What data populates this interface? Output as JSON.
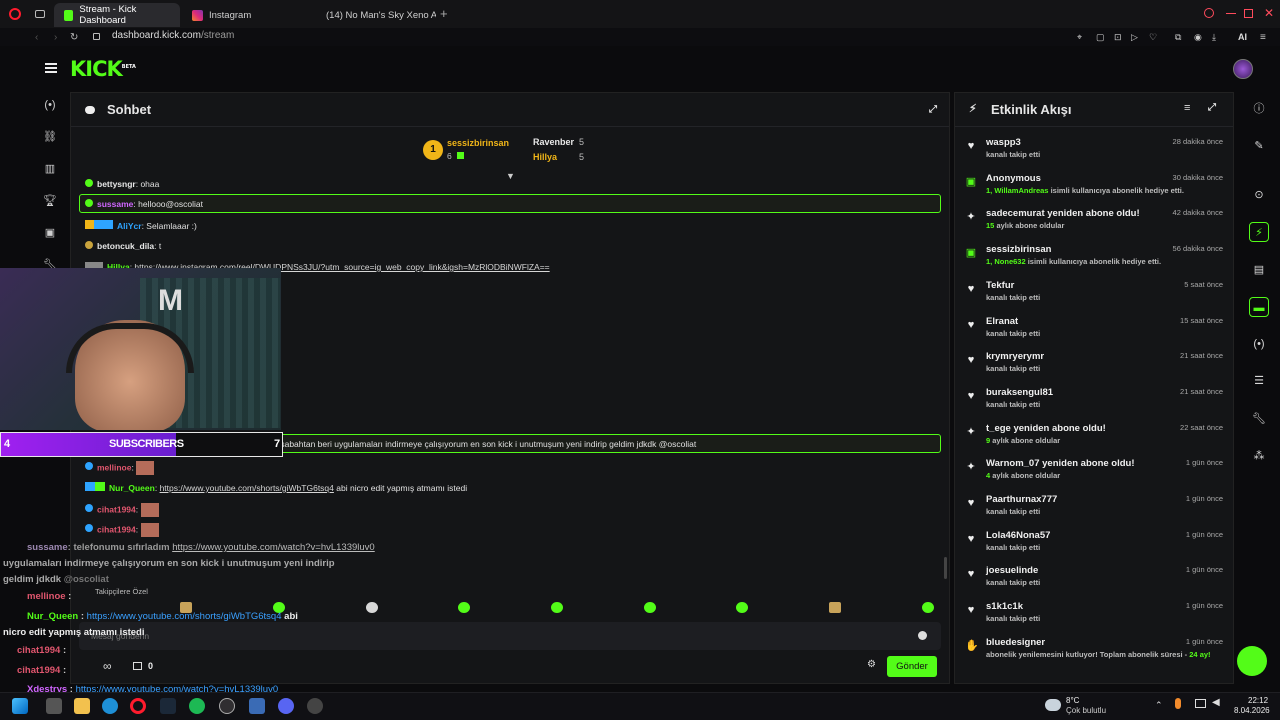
{
  "browser": {
    "tabs": [
      {
        "label": "Stream - Kick Dashboard",
        "color": "#53fc18"
      },
      {
        "label": "Instagram",
        "color": "#e1306c"
      },
      {
        "label": "(14) No Man's Sky Xeno A",
        "color": "#ff0000"
      }
    ],
    "url_host": "dashboard.kick.com",
    "url_path": "/stream",
    "ai_label": "AI"
  },
  "kick": {
    "logo": "KICK",
    "beta": "BETA"
  },
  "chat": {
    "title": "Sohbet",
    "top_supporters": [
      {
        "rank": "1",
        "name": "sessizbirinsan",
        "count": "6"
      },
      {
        "name": "Ravenber",
        "count": "5"
      },
      {
        "name": "Hillya",
        "count": "5"
      }
    ],
    "messages": [
      {
        "user": "bettysngr",
        "text": ": ohaa",
        "color": "#e8e8e8"
      },
      {
        "user": "sussame",
        "text": ": hellooo@oscoliat",
        "color": "#d066ff"
      },
      {
        "user": "AliYcr",
        "text": ": Selamlaaar :)",
        "color": "#2ea4ff"
      },
      {
        "user": "betoncuk_dila",
        "text": ": t",
        "color": "#e8e8e8"
      },
      {
        "user": "Hillya",
        "link": "https://www.instagram.com/reel/DWUDPNSs3JU/?utm_source=ig_web_copy_link&igsh=MzRlODBiNWFlZA==",
        "color": "#53fc18"
      },
      {
        "text": "onumu sıfırladım yanlışlıkla sabahtan beri uygulamaları indirmeye çalışıyorum en son kick i unutmuşum yeni indirip geldim jdkdk @oscoliat"
      },
      {
        "user": "mellinoe",
        "text": ":",
        "color": "#e0566e"
      },
      {
        "user": "Nur_Queen",
        "link": "https://www.youtube.com/shorts/giWbTG6tsq4",
        "text": "abi nicro edit yapmış atmamı istedi",
        "color": "#53fc18"
      },
      {
        "user": "cihat1994",
        "text": ":",
        "color": "#e0566e"
      },
      {
        "user": "cihat1994",
        "text": ":",
        "color": "#e0566e"
      }
    ],
    "overlay": {
      "l1_user": "sussame",
      "l1_text": ": telefonumu sıfırladım",
      "l1_link": "https://www.youtube.com/watch?v=hvL1339luv0",
      "l2": "uygulamaları indirmeye çalışıyorum en son kick i unutmuşum yeni indirip",
      "l3": "geldim jdkdk",
      "l3_mention": "@oscoliat",
      "l4_user": "mellinoe",
      "l5_user": "Nur_Queen",
      "l5_link": "https://www.youtube.com/shorts/giWbTG6tsq4",
      "l5_text": "abi",
      "l6": "nicro edit yapmış atmamı istedi",
      "l7_user": "cihat1994",
      "l8_user": "cihat1994",
      "l9_user": "Xdestrys",
      "l9_link": "https://www.youtube.com/watch?v=hvL1339luv0"
    },
    "followers_only": "Takipçilere Özel",
    "input_placeholder": "Mesaj gönderin",
    "infinity": "∞",
    "count": "0",
    "send_label": "Gönder",
    "webcam_counter_left": "4",
    "webcam_counter_right": "7",
    "subscribers_label": "SUBSCRIBERS"
  },
  "activity": {
    "title": "Etkinlik Akışı",
    "items": [
      {
        "icon": "heart",
        "name": "waspp3",
        "sub": "kanalı takip etti",
        "time": "28 dakika önce"
      },
      {
        "icon": "gift",
        "name": "Anonymous",
        "sub_count": "1,",
        "sub_user": "WillamAndreas",
        "sub": "isimli kullanıcıya abonelik hediye etti.",
        "time": "30 dakika önce"
      },
      {
        "icon": "star",
        "name": "sadecemurat yeniden abone oldu!",
        "sub_count": "15",
        "sub": "aylık abone oldular",
        "time": "42 dakika önce"
      },
      {
        "icon": "gift",
        "name": "sessizbirinsan",
        "sub_count": "1,",
        "sub_user": "None632",
        "sub": "isimli kullanıcıya abonelik hediye etti.",
        "time": "56 dakika önce"
      },
      {
        "icon": "heart",
        "name": "Tekfur",
        "sub": "kanalı takip etti",
        "time": "5 saat önce"
      },
      {
        "icon": "heart",
        "name": "Elranat",
        "sub": "kanalı takip etti",
        "time": "15 saat önce"
      },
      {
        "icon": "heart",
        "name": "krymryerymr",
        "sub": "kanalı takip etti",
        "time": "21 saat önce"
      },
      {
        "icon": "heart",
        "name": "buraksengul81",
        "sub": "kanalı takip etti",
        "time": "21 saat önce"
      },
      {
        "icon": "star",
        "name": "t_ege yeniden abone oldu!",
        "sub_count": "9",
        "sub": "aylık abone oldular",
        "time": "22 saat önce"
      },
      {
        "icon": "star",
        "name": "Warnom_07 yeniden abone oldu!",
        "sub_count": "4",
        "sub": "aylık abone oldular",
        "time": "1 gün önce"
      },
      {
        "icon": "heart",
        "name": "Paarthurnax777",
        "sub": "kanalı takip etti",
        "time": "1 gün önce"
      },
      {
        "icon": "heart",
        "name": "Lola46Nona57",
        "sub": "kanalı takip etti",
        "time": "1 gün önce"
      },
      {
        "icon": "heart",
        "name": "joesuelinde",
        "sub": "kanalı takip etti",
        "time": "1 gün önce"
      },
      {
        "icon": "heart",
        "name": "s1k1c1k",
        "sub": "kanalı takip etti",
        "time": "1 gün önce"
      },
      {
        "icon": "handshake",
        "name": "bluedesigner",
        "sub": "abonelik yenilemesini kutluyor! Toplam abonelik süresi -",
        "sub_count": "24 ay!",
        "time": "1 gün önce"
      }
    ]
  },
  "taskbar": {
    "weather_temp": "8°C",
    "weather_desc": "Çok bulutlu",
    "time": "22:12",
    "date": "8.04.2026"
  },
  "colors": {
    "accent": "#53fc18",
    "panel": "#141517",
    "bg": "#0b0b0d"
  }
}
